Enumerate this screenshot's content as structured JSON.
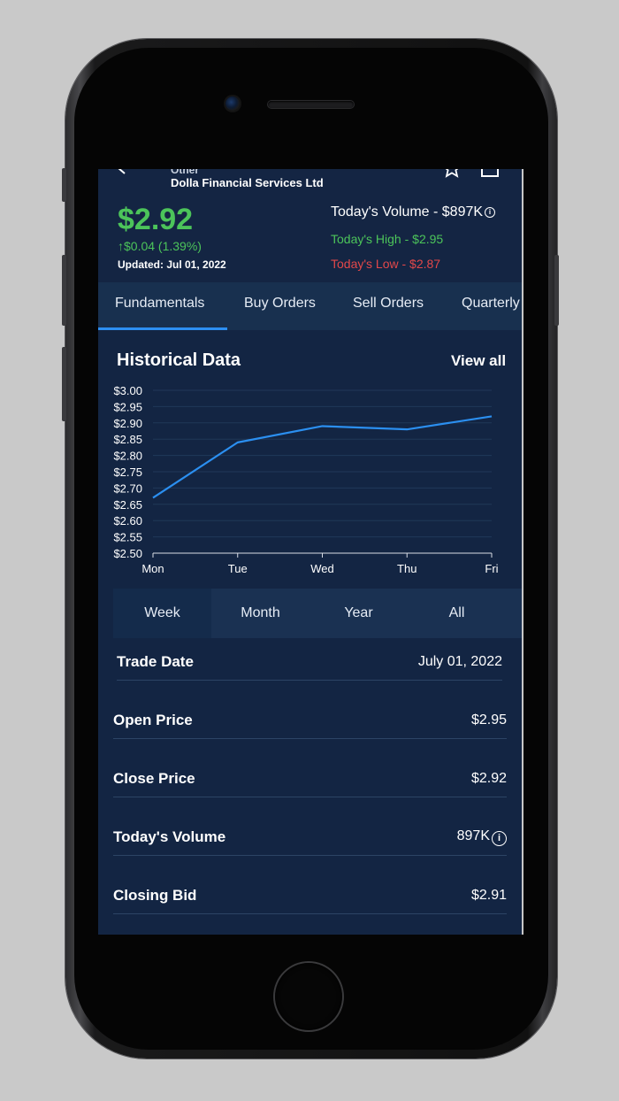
{
  "header": {
    "category": "Other",
    "company": "Dolla Financial Services Ltd",
    "price": "$2.92",
    "change": "$0.04 (1.39%)",
    "updated": "Updated: Jul 01, 2022",
    "volume": "Today's Volume - $897K",
    "high": "Today's High - $2.95",
    "low": "Today's Low - $2.87",
    "icons": [
      "back-arrow-icon",
      "bookmark-icon",
      "share-icon",
      "info-icon"
    ]
  },
  "tabs": [
    {
      "label": "Fundamentals"
    },
    {
      "label": "Buy Orders"
    },
    {
      "label": "Sell Orders"
    },
    {
      "label": "Quarterly"
    }
  ],
  "historical": {
    "title": "Historical Data",
    "view_all": "View all"
  },
  "chart_data": {
    "type": "line",
    "categories": [
      "Mon",
      "Tue",
      "Wed",
      "Thu",
      "Fri"
    ],
    "values": [
      2.67,
      2.84,
      2.89,
      2.88,
      2.92
    ],
    "y_ticks": [
      "$3.00",
      "$2.95",
      "$2.90",
      "$2.85",
      "$2.80",
      "$2.75",
      "$2.70",
      "$2.65",
      "$2.60",
      "$2.55",
      "$2.50"
    ],
    "ylim": [
      2.5,
      3.0
    ],
    "grid": true,
    "line_color": "#2b8ff0"
  },
  "ranges": [
    {
      "label": "Week",
      "active": true
    },
    {
      "label": "Month"
    },
    {
      "label": "Year"
    },
    {
      "label": "All"
    }
  ],
  "rows": [
    {
      "label": "Trade Date",
      "value": "July 01, 2022"
    },
    {
      "label": "Open Price",
      "value": "$2.95"
    },
    {
      "label": "Close Price",
      "value": "$2.92"
    },
    {
      "label": "Today's Volume",
      "value": "897K"
    },
    {
      "label": "Closing Bid",
      "value": "$2.91"
    }
  ],
  "colors": {
    "background": "#132543",
    "positive": "#4cc45a",
    "negative": "#e2484a",
    "accent": "#2d8ff2"
  }
}
